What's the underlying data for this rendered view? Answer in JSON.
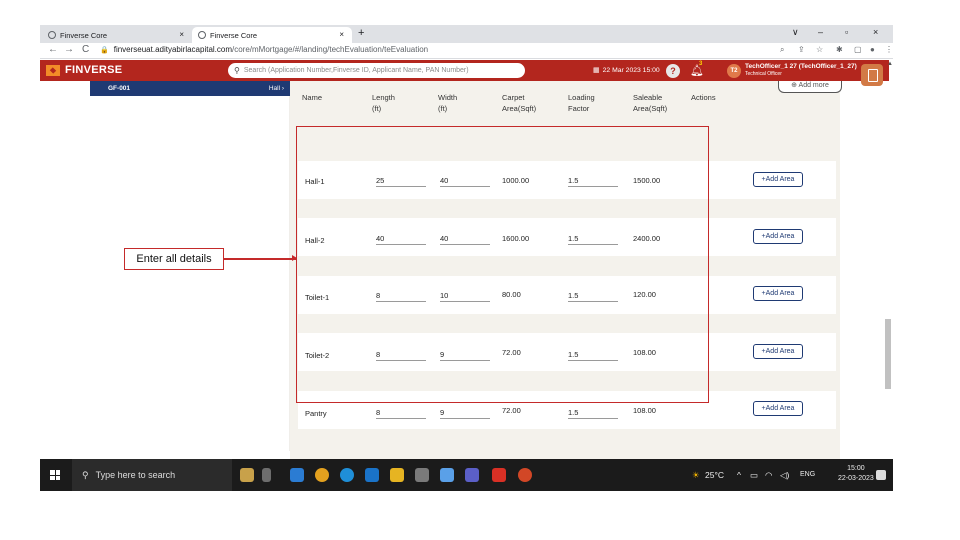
{
  "browser": {
    "tabs": [
      {
        "title": "Finverse Core",
        "close": "×"
      },
      {
        "title": "Finverse Core",
        "close": "×"
      }
    ],
    "new_tab": "+",
    "window_controls": [
      "∨",
      "–",
      "▫",
      "×"
    ],
    "nav": {
      "back": "←",
      "forward": "→",
      "reload": "C"
    },
    "url_domain": "finverseuat.adityabirlacapital.com",
    "url_path": "/core/mMortgage/#/landing/techEvaluation/teEvaluation"
  },
  "header": {
    "logo": "FINVERSE",
    "search_placeholder": "Search (Application Number,Finverse ID, Applicant Name, PAN Number)",
    "datetime": "22 Mar 2023 15:00",
    "notification_count": "3",
    "avatar_initials": "T2",
    "user_name": "TechOfficer_1 27 (TechOfficer_1_27)",
    "user_role": "Technical Officer"
  },
  "left_panel": {
    "selected_code": "GF-001",
    "selected_label": "Hall ›"
  },
  "add_more_label": "⊕ Add more",
  "table": {
    "headers": [
      {
        "l1": "",
        "l2": "Name"
      },
      {
        "l1": "Length",
        "l2": "(ft)"
      },
      {
        "l1": "Width",
        "l2": "(ft)"
      },
      {
        "l1": "Carpet",
        "l2": "Area(Sqft)"
      },
      {
        "l1": "Loading",
        "l2": "Factor"
      },
      {
        "l1": "Saleable",
        "l2": "Area(Sqft)"
      },
      {
        "l1": "",
        "l2": "Actions"
      }
    ],
    "rows": [
      {
        "name": "Hall-1",
        "length": "25",
        "width": "40",
        "carpet": "1000.00",
        "factor": "1.5",
        "saleable": "1500.00",
        "action": "+Add Area"
      },
      {
        "name": "Hall-2",
        "length": "40",
        "width": "40",
        "carpet": "1600.00",
        "factor": "1.5",
        "saleable": "2400.00",
        "action": "+Add Area"
      },
      {
        "name": "Toilet-1",
        "length": "8",
        "width": "10",
        "carpet": "80.00",
        "factor": "1.5",
        "saleable": "120.00",
        "action": "+Add Area"
      },
      {
        "name": "Toilet-2",
        "length": "8",
        "width": "9",
        "carpet": "72.00",
        "factor": "1.5",
        "saleable": "108.00",
        "action": "+Add Area"
      },
      {
        "name": "Pantry",
        "length": "8",
        "width": "9",
        "carpet": "72.00",
        "factor": "1.5",
        "saleable": "108.00",
        "action": "+Add Area"
      }
    ]
  },
  "annotation": {
    "callout": "Enter all details"
  },
  "taskbar": {
    "search_placeholder": "Type here to search",
    "weather": "25°C",
    "lang": "ENG",
    "time": "15:00",
    "date": "22-03-2023"
  },
  "colors": {
    "header_red": "#b3261e",
    "nav_blue": "#1f3a73",
    "annotation_red": "#c42a2a"
  }
}
